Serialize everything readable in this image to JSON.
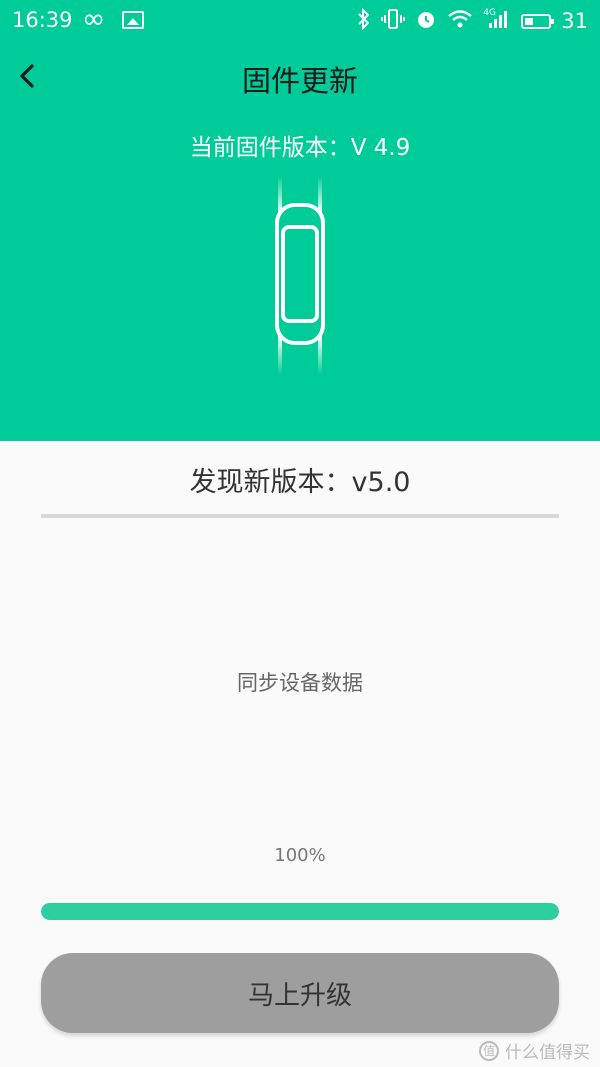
{
  "statusbar": {
    "time": "16:39",
    "battery_percent": "31",
    "network_label": "4G"
  },
  "header": {
    "title": "固件更新"
  },
  "firmware": {
    "current_version": "当前固件版本：V 4.9",
    "new_version": "发现新版本：v5.0"
  },
  "sync": {
    "label": "同步设备数据",
    "progress_text": "100%",
    "progress_value": 1.0
  },
  "actions": {
    "upgrade_label": "马上升级"
  },
  "watermark": {
    "logo": "值",
    "text": "什么值得买"
  },
  "colors": {
    "primary": "#00cc99",
    "progress": "#2dcf9f",
    "button": "#9e9e9e"
  }
}
